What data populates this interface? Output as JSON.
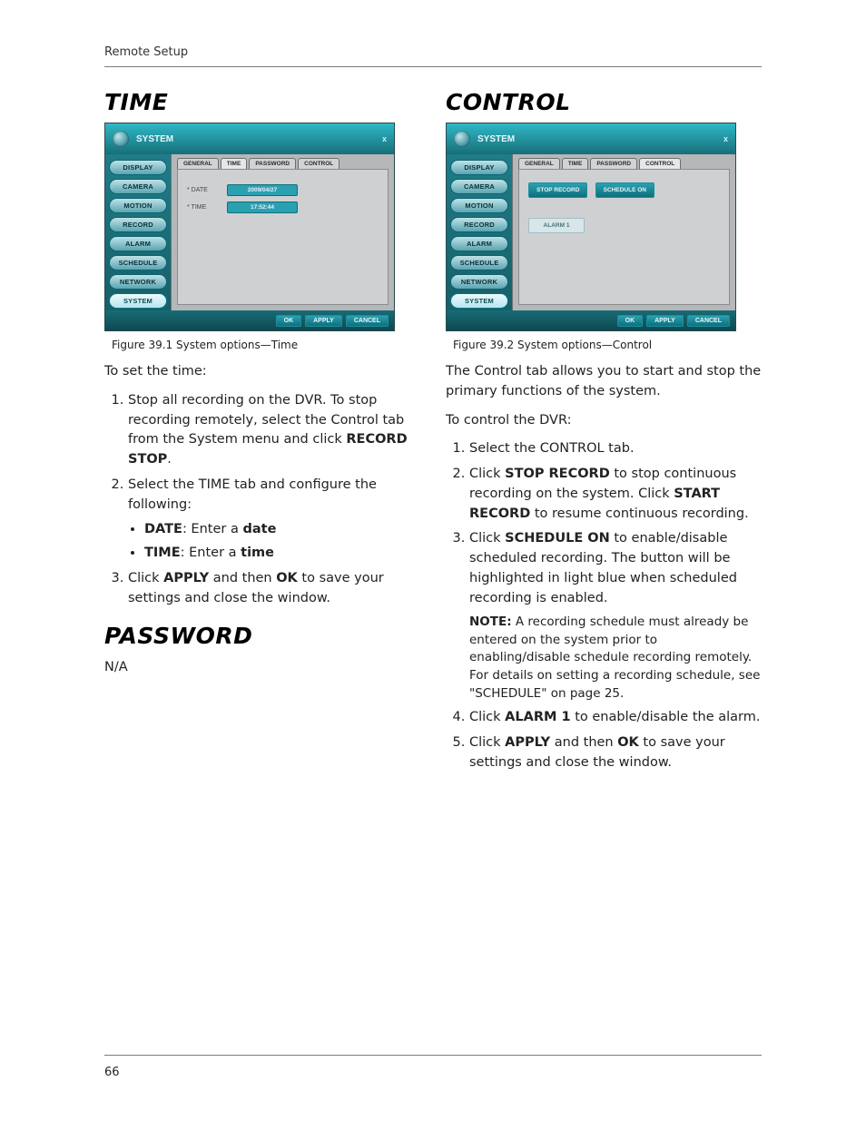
{
  "header": {
    "running": "Remote Setup"
  },
  "page_number": "66",
  "left": {
    "time": {
      "heading": "Time",
      "caption": "Figure 39.1 System options—Time",
      "intro": "To set the time:",
      "step1_a": "Stop all recording on the DVR. To stop recording remotely, select the Control tab from the System menu and click ",
      "step1_b_strong": "RECORD STOP",
      "step1_c": ".",
      "step2": "Select the TIME tab and configure the following:",
      "bulletA": {
        "label": "DATE",
        "mid": ": Enter a ",
        "val": "date"
      },
      "bulletB": {
        "label": "TIME",
        "mid": ": Enter a ",
        "val": "time"
      },
      "step3_a": "Click ",
      "step3_b": "APPLY",
      "step3_c": " and then ",
      "step3_d": "OK",
      "step3_e": " to save your settings and close the window."
    },
    "password": {
      "heading": "Password",
      "body": "N/A"
    }
  },
  "right": {
    "control": {
      "heading": "Control",
      "caption": "Figure 39.2 System options—Control",
      "intro_para": "The Control tab allows you to start and stop the primary functions of the system.",
      "intro": "To control the DVR:",
      "step1": "Select the CONTROL tab.",
      "step2_a": "Click ",
      "step2_b": "STOP RECORD",
      "step2_c": " to stop continuous recording on the system. Click ",
      "step2_d": "START RECORD",
      "step2_e": " to resume continuous recording.",
      "step3_a": "Click ",
      "step3_b": "SCHEDULE ON",
      "step3_c": " to enable/disable scheduled recording. The button will be highlighted in light blue when scheduled recording is enabled.",
      "note_label": "NOTE:",
      "note_body": " A recording schedule must already be entered on the system prior to enabling/disable schedule recording remotely. For details on setting a recording schedule, see \"SCHEDULE\" on page 25.",
      "step4_a": "Click ",
      "step4_b": "ALARM 1",
      "step4_c": " to enable/disable the alarm.",
      "step5_a": "Click ",
      "step5_b": "APPLY",
      "step5_c": " and then ",
      "step5_d": "OK",
      "step5_e": " to save your settings and close the window."
    }
  },
  "shot_common": {
    "title": "SYSTEM",
    "close": "x",
    "sidebar": [
      "DISPLAY",
      "CAMERA",
      "MOTION",
      "RECORD",
      "ALARM",
      "SCHEDULE",
      "NETWORK",
      "SYSTEM"
    ],
    "tabs": [
      "GENERAL",
      "TIME",
      "PASSWORD",
      "CONTROL"
    ],
    "footer": [
      "OK",
      "APPLY",
      "CANCEL"
    ]
  },
  "shot_time": {
    "date_label": "* DATE",
    "date_value": "2009/04/27",
    "time_label": "* TIME",
    "time_value": "17:52:44"
  },
  "shot_control": {
    "btn_stop": "STOP RECORD",
    "btn_sched": "SCHEDULE ON",
    "btn_alarm": "ALARM 1"
  }
}
